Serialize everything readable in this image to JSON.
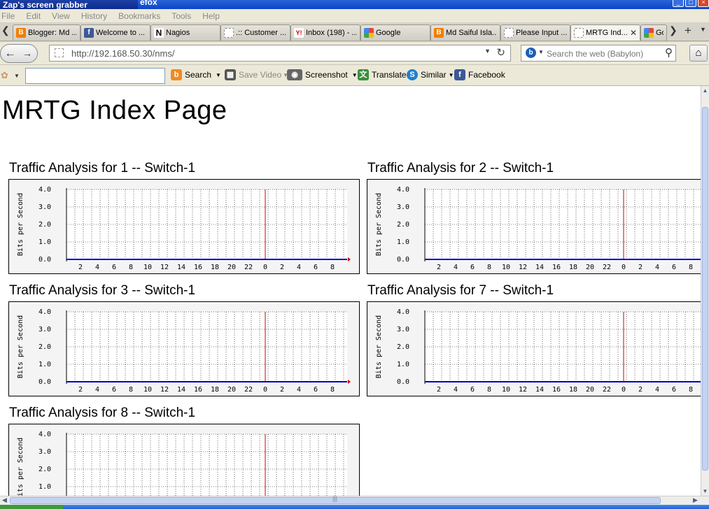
{
  "window": {
    "title": "efox",
    "overlay_title": "Zap's screen grabber"
  },
  "menu": [
    "File",
    "Edit",
    "View",
    "History",
    "Bookmarks",
    "Tools",
    "Help"
  ],
  "tabs": [
    {
      "label": "Blogger: Md ...",
      "icon": "blogger-icon"
    },
    {
      "label": "Welcome to ...",
      "icon": "facebook-icon"
    },
    {
      "label": "Nagios",
      "icon": "nagios-icon"
    },
    {
      "label": ".:: Customer ...",
      "icon": "blank-page-icon"
    },
    {
      "label": "Inbox (198) - ...",
      "icon": "yahoo-icon"
    },
    {
      "label": "Google",
      "icon": "google-icon"
    },
    {
      "label": "Md Saiful Isla...",
      "icon": "blogger-icon"
    },
    {
      "label": "Please Input ...",
      "icon": "blank-page-icon"
    },
    {
      "label": "MRTG Ind...",
      "icon": "blank-page-icon",
      "active": true
    },
    {
      "label": "Go",
      "icon": "google-icon"
    }
  ],
  "address": {
    "url": "http://192.168.50.30/nms/"
  },
  "search": {
    "placeholder": "Search the web (Babylon)"
  },
  "toolbar": {
    "search_label": "Search",
    "save_video_label": "Save Video",
    "screenshot_label": "Screenshot",
    "translate_label": "Translate",
    "similar_label": "Similar",
    "facebook_label": "Facebook"
  },
  "page": {
    "title": "MRTG Index Page",
    "graphs": [
      {
        "title": "Traffic Analysis for 1 -- Switch-1"
      },
      {
        "title": "Traffic Analysis for 2 -- Switch-1"
      },
      {
        "title": "Traffic Analysis for 3 -- Switch-1"
      },
      {
        "title": "Traffic Analysis for 7 -- Switch-1"
      },
      {
        "title": "Traffic Analysis for 8 -- Switch-1"
      }
    ]
  },
  "chart_data": {
    "type": "line",
    "ylabel": "Bits per Second",
    "y_ticks": [
      "4.0",
      "3.0",
      "2.0",
      "1.0",
      "0.0"
    ],
    "x_ticks": [
      "2",
      "4",
      "6",
      "8",
      "10",
      "12",
      "14",
      "16",
      "18",
      "20",
      "22",
      "0",
      "2",
      "4",
      "6",
      "8"
    ],
    "ylim": [
      0,
      4
    ],
    "grid": true,
    "series": [
      {
        "values": [
          0,
          0,
          0,
          0,
          0,
          0,
          0,
          0,
          0,
          0,
          0,
          0,
          0,
          0,
          0,
          0
        ],
        "color": "#0000cc"
      }
    ],
    "marker_line_label": "0",
    "marker_line_color": "#cc0000"
  }
}
